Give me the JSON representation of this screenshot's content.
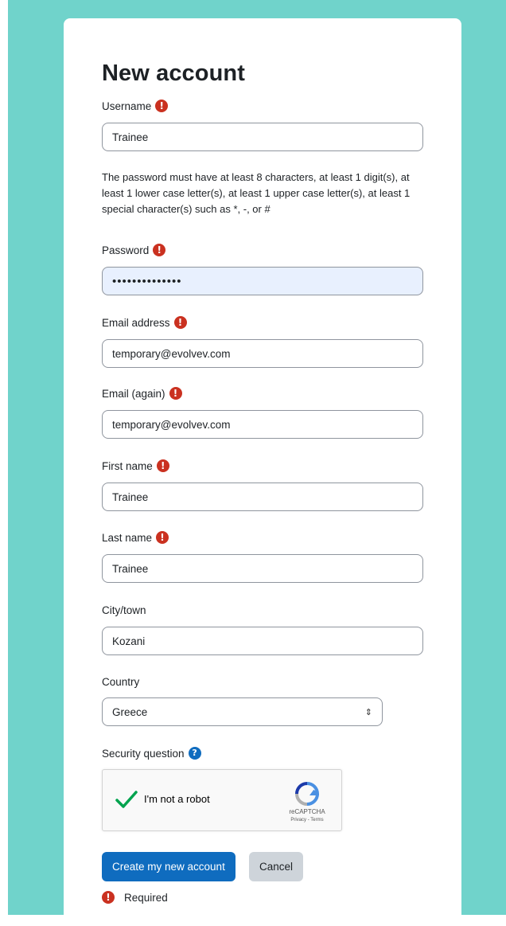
{
  "page": {
    "title": "New account"
  },
  "fields": {
    "username": {
      "label": "Username",
      "value": "Trainee"
    },
    "password_rule": "The password must have at least 8 characters, at least 1 digit(s), at least 1 lower case letter(s), at least 1 upper case letter(s), at least 1 special character(s) such as *, -, or #",
    "password": {
      "label": "Password",
      "value": "••••••••••••••"
    },
    "email": {
      "label": "Email address",
      "value": "temporary@evolvev.com"
    },
    "email_again": {
      "label": "Email (again)",
      "value": "temporary@evolvev.com"
    },
    "first_name": {
      "label": "First name",
      "value": "Trainee"
    },
    "last_name": {
      "label": "Last name",
      "value": "Trainee"
    },
    "city": {
      "label": "City/town",
      "value": "Kozani"
    },
    "country": {
      "label": "Country",
      "selected": "Greece"
    },
    "security": {
      "label": "Security question"
    }
  },
  "captcha": {
    "label": "I'm not a robot",
    "brand": "reCAPTCHA",
    "links": "Privacy - Terms",
    "checked": true
  },
  "buttons": {
    "create": "Create my new account",
    "cancel": "Cancel"
  },
  "footer": {
    "required_label": "Required"
  },
  "icons": {
    "required": "exclamation-circle-icon",
    "help": "question-circle-icon"
  },
  "colors": {
    "background": "#70d3cb",
    "primary": "#0f6cbf",
    "required": "#ca3120",
    "secondary": "#ced4da",
    "check": "#00a34e"
  }
}
